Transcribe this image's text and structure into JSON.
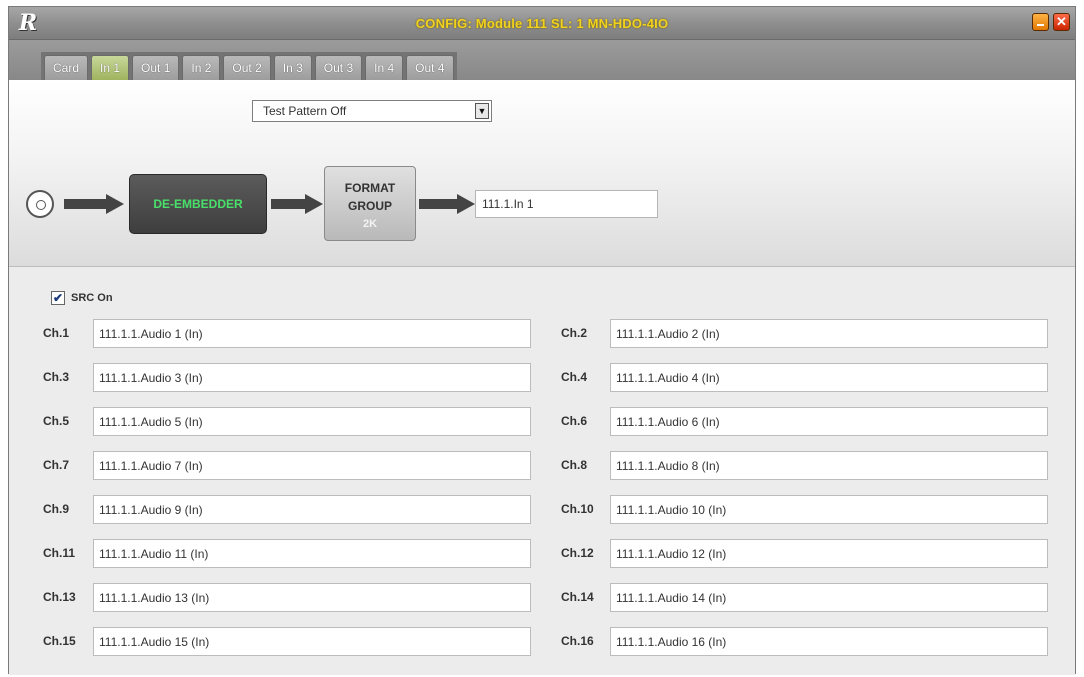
{
  "window": {
    "logo": "R",
    "title": "CONFIG: Module 111  SL: 1 MN-HDO-4IO",
    "close_glyph": "✕"
  },
  "tabs": [
    "Card",
    "In 1",
    "Out 1",
    "In 2",
    "Out 2",
    "In 3",
    "Out 3",
    "In 4",
    "Out 4"
  ],
  "active_tab": "In 1",
  "top": {
    "test_pattern": "Test Pattern Off",
    "deembedder_label": "DE-EMBEDDER",
    "format_group": {
      "line1": "FORMAT",
      "line2": "GROUP",
      "sub": "2K"
    },
    "signal_name": "111.1.In 1"
  },
  "src": {
    "label": "SRC On",
    "checked": true
  },
  "channels": [
    {
      "label": "Ch.1",
      "value": "111.1.1.Audio 1 (In)"
    },
    {
      "label": "Ch.2",
      "value": "111.1.1.Audio 2 (In)"
    },
    {
      "label": "Ch.3",
      "value": "111.1.1.Audio 3 (In)"
    },
    {
      "label": "Ch.4",
      "value": "111.1.1.Audio 4 (In)"
    },
    {
      "label": "Ch.5",
      "value": "111.1.1.Audio 5 (In)"
    },
    {
      "label": "Ch.6",
      "value": "111.1.1.Audio 6 (In)"
    },
    {
      "label": "Ch.7",
      "value": "111.1.1.Audio 7 (In)"
    },
    {
      "label": "Ch.8",
      "value": "111.1.1.Audio 8 (In)"
    },
    {
      "label": "Ch.9",
      "value": "111.1.1.Audio 9 (In)"
    },
    {
      "label": "Ch.10",
      "value": "111.1.1.Audio 10 (In)"
    },
    {
      "label": "Ch.11",
      "value": "111.1.1.Audio 11 (In)"
    },
    {
      "label": "Ch.12",
      "value": "111.1.1.Audio 12 (In)"
    },
    {
      "label": "Ch.13",
      "value": "111.1.1.Audio 13 (In)"
    },
    {
      "label": "Ch.14",
      "value": "111.1.1.Audio 14 (In)"
    },
    {
      "label": "Ch.15",
      "value": "111.1.1.Audio 15 (In)"
    },
    {
      "label": "Ch.16",
      "value": "111.1.1.Audio 16 (In)"
    }
  ]
}
